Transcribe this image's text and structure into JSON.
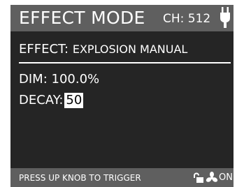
{
  "header": {
    "title": "EFFECT MODE",
    "channel": "CH: 512",
    "icon": "plug-icon"
  },
  "effect": {
    "label": "EFFECT:",
    "name": "EXPLOSION MANUAL"
  },
  "params": {
    "dim": {
      "label": "DIM:",
      "value": "100.0%"
    },
    "decay": {
      "label": "DECAY:",
      "value": "50"
    }
  },
  "footer": {
    "hint": "PRESS UP KNOB TO TRIGGER",
    "fan_state": "ON",
    "icons": [
      "unlock-icon",
      "fan-icon"
    ]
  },
  "colors": {
    "background": "#252525",
    "bar": "#5f5f5f",
    "text": "#ffffff",
    "highlight": "#ffffff"
  }
}
